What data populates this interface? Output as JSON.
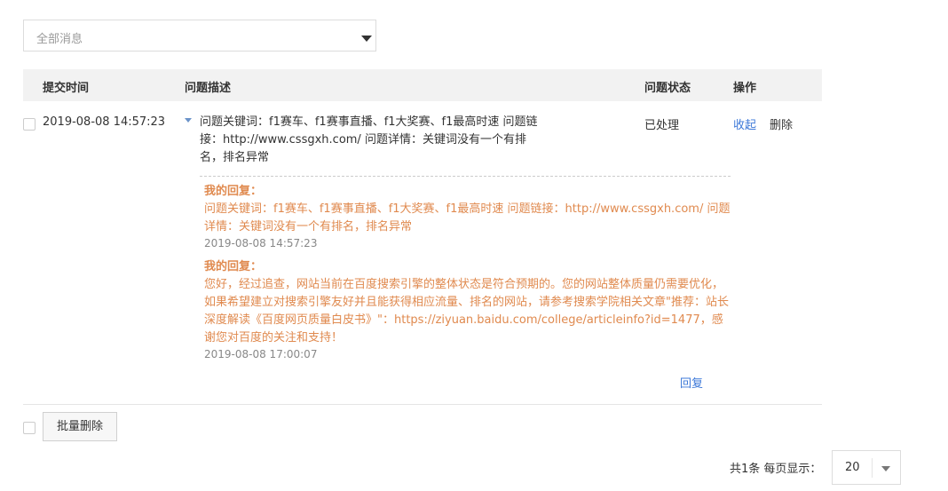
{
  "filter": {
    "selected": "全部消息"
  },
  "table": {
    "headers": {
      "time": "提交时间",
      "description": "问题描述",
      "status": "问题状态",
      "operations": "操作"
    },
    "rows": [
      {
        "time": "2019-08-08 14:57:23",
        "description": "问题关键词：f1赛车、f1赛事直播、f1大奖赛、f1最高时速 问题链接：http://www.cssgxh.com/ 问题详情：关键词没有一个有排名，排名异常",
        "status": "已处理",
        "collapse_label": "收起",
        "delete_label": "删除",
        "replies": [
          {
            "title": "我的回复：",
            "content": "问题关键词：f1赛车、f1赛事直播、f1大奖赛、f1最高时速 问题链接：http://www.cssgxh.com/ 问题详情：关键词没有一个有排名，排名异常",
            "time": "2019-08-08 14:57:23"
          },
          {
            "title": "我的回复：",
            "content": "您好，经过追查，网站当前在百度搜索引擎的整体状态是符合预期的。您的网站整体质量仍需要优化，如果希望建立对搜索引擎友好并且能获得相应流量、排名的网站，请参考搜索学院相关文章\"推荐：站长深度解读《百度网页质量白皮书》\"：https://ziyuan.baidu.com/college/articleinfo?id=1477，感谢您对百度的关注和支持！",
            "time": "2019-08-08 17:00:07"
          }
        ],
        "reply_label": "回复"
      }
    ]
  },
  "footer": {
    "batch_delete_label": "批量删除",
    "total_text": "共1条 每页显示：",
    "page_size": "20"
  },
  "colors": {
    "accent_link": "#3c78d8",
    "reply_text": "#e08a4f",
    "header_bg": "#f2f2f2"
  }
}
